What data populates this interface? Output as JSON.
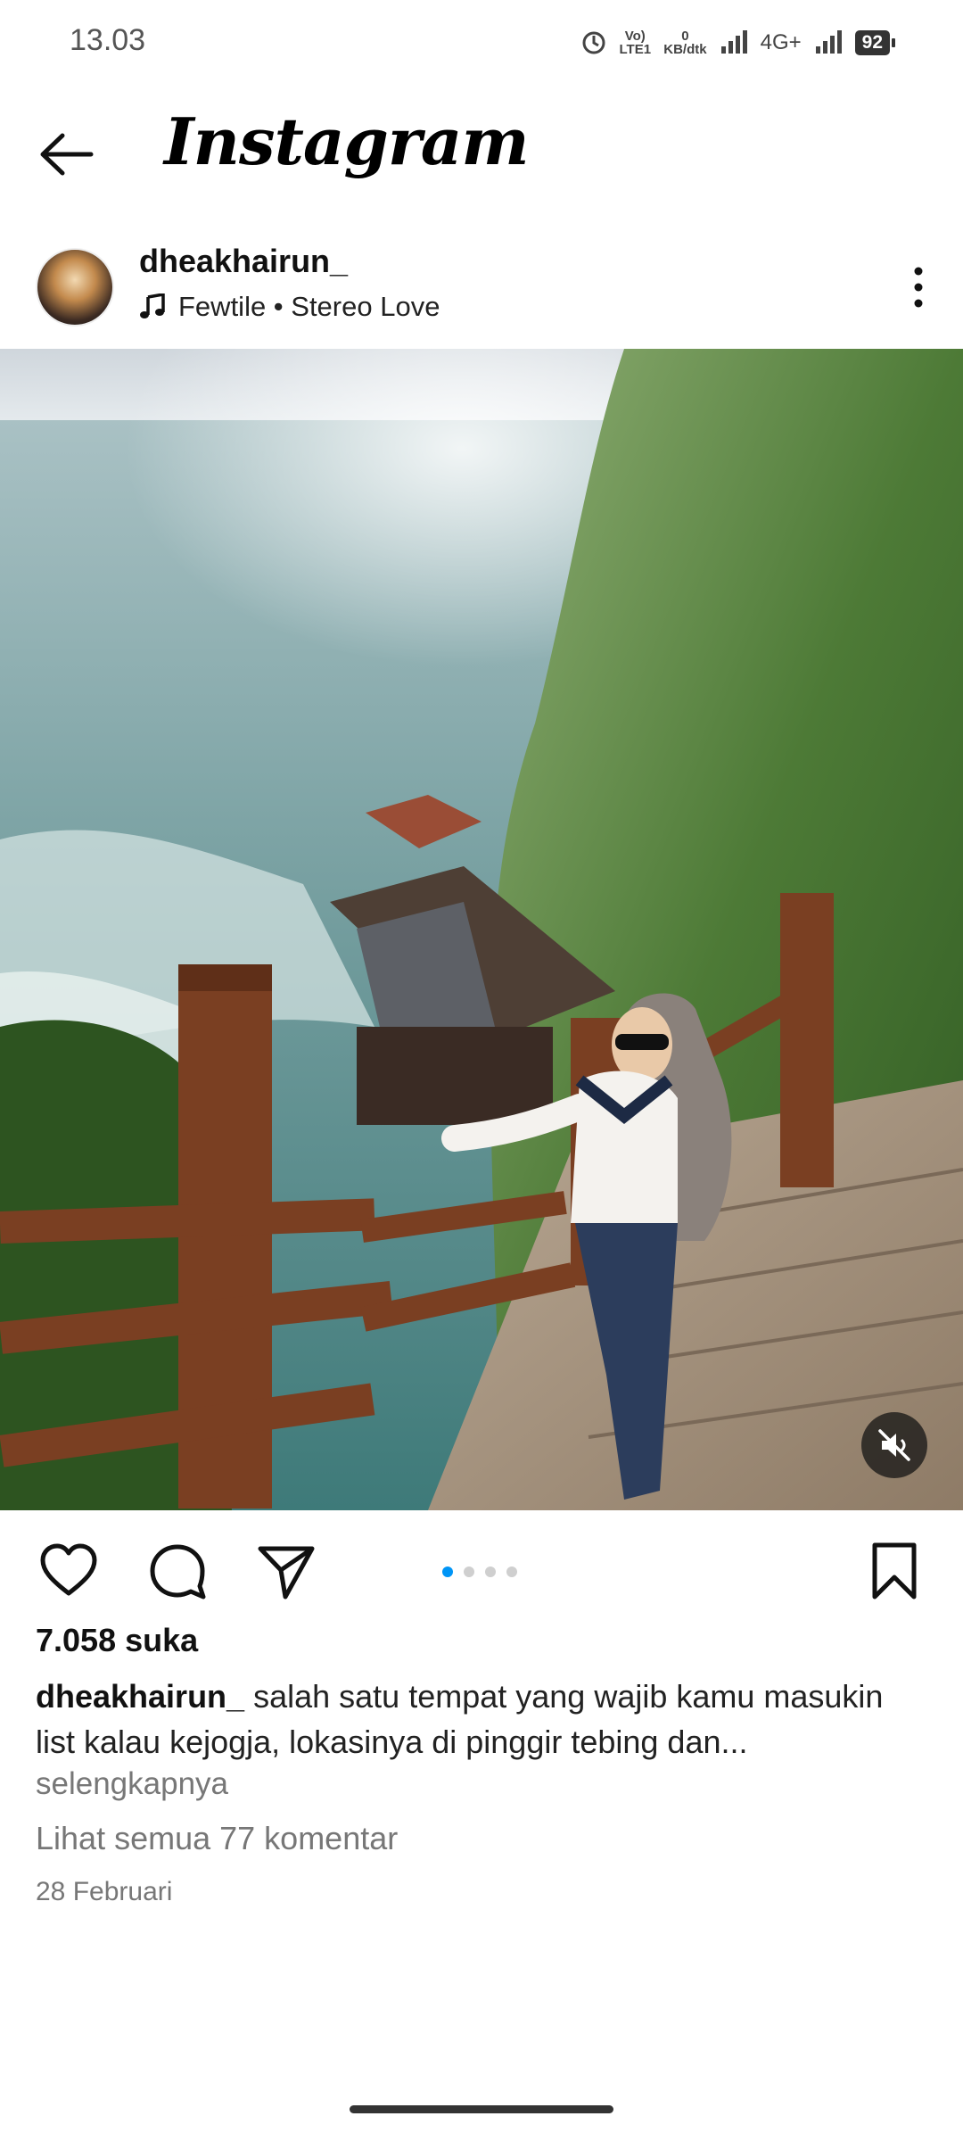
{
  "status_bar": {
    "time": "13.03",
    "volte": "Vo) LTE1",
    "speed_value": "0",
    "speed_unit": "KB/dtk",
    "network": "4G+",
    "battery": "92"
  },
  "nav": {
    "brand": "Instagram"
  },
  "post": {
    "username": "dheakhairun_",
    "music": "Fewtile • Stereo Love",
    "likes": "7.058 suka",
    "caption_user": "dheakhairun_",
    "caption_text": " salah satu tempat yang wajib kamu masukin list kalau kejogja, lokasinya di pinggir tebing dan...",
    "more_label": "selengkapnya",
    "comments_link": "Lihat semua 77 komentar",
    "date": "28 Februari",
    "carousel": {
      "total": 4,
      "active_index": 0
    }
  },
  "colors": {
    "accent": "#0095f6",
    "muted_text": "#777777"
  },
  "icons": [
    "back-arrow-icon",
    "music-note-icon",
    "more-vertical-icon",
    "mute-icon",
    "heart-icon",
    "comment-icon",
    "share-icon",
    "bookmark-icon"
  ]
}
